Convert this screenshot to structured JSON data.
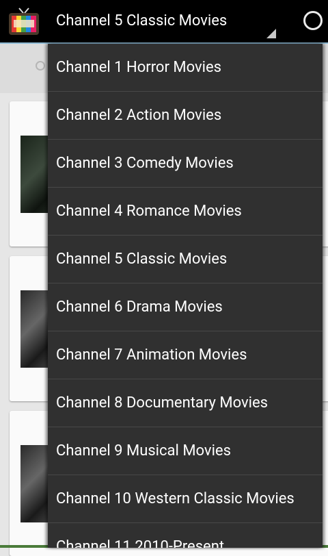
{
  "actionbar": {
    "selected_channel": "Channel 5 Classic Movies",
    "colors": {
      "background": "#000000",
      "divider": "#8fbcd6"
    }
  },
  "dropdown": {
    "background": "#303030",
    "items": [
      {
        "label": "Channel 1 Horror Movies"
      },
      {
        "label": "Channel 2 Action Movies"
      },
      {
        "label": "Channel 3 Comedy Movies"
      },
      {
        "label": "Channel 4 Romance Movies"
      },
      {
        "label": "Channel 5 Classic Movies"
      },
      {
        "label": "Channel 6 Drama Movies"
      },
      {
        "label": "Channel 7 Animation Movies"
      },
      {
        "label": "Channel 8 Documentary Movies"
      },
      {
        "label": "Channel 9 Musical Movies"
      },
      {
        "label": "Channel 10 Western Classic Movies"
      },
      {
        "label": "Channel 11 2010-Present"
      }
    ]
  },
  "icons": {
    "app": "tv-icon",
    "progress": "loading-spinner-icon",
    "search": "search-icon"
  }
}
